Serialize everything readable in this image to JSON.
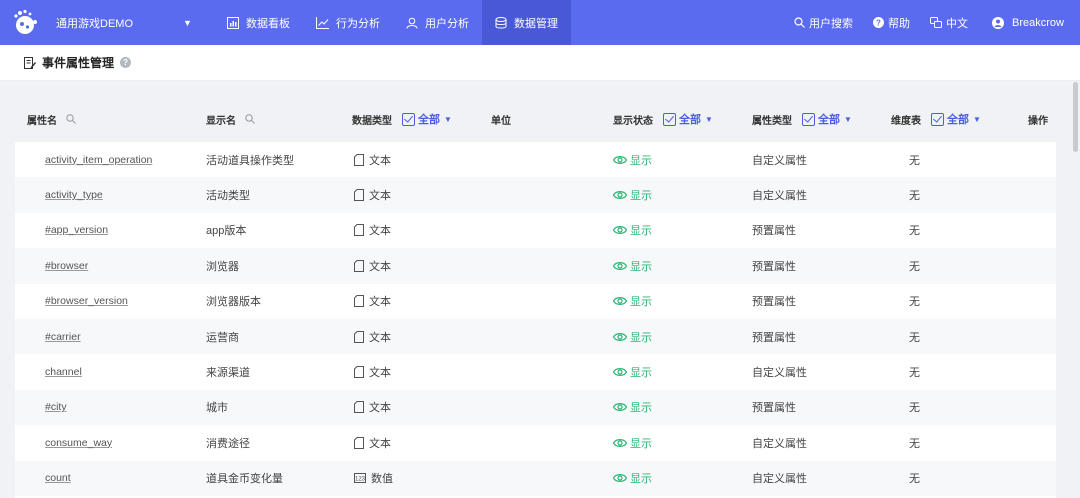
{
  "app": {
    "project": "通用游戏DEMO",
    "nav": [
      {
        "label": "数据看板",
        "icon": "dashboard-icon"
      },
      {
        "label": "行为分析",
        "icon": "trend-chart-icon"
      },
      {
        "label": "用户分析",
        "icon": "user-icon"
      },
      {
        "label": "数据管理",
        "icon": "database-icon",
        "active": true
      }
    ],
    "right": {
      "search": "用户搜索",
      "help": "帮助",
      "lang": "中文",
      "user": "Breakcrow"
    }
  },
  "page": {
    "title": "事件属性管理"
  },
  "table": {
    "headers": {
      "name": "属性名",
      "display": "显示名",
      "datatype": "数据类型",
      "unit": "单位",
      "status": "显示状态",
      "proptype": "属性类型",
      "dim": "维度表",
      "ops": "操作"
    },
    "filter_all": "全部",
    "rows": [
      {
        "name": "activity_item_operation",
        "display": "活动道具操作类型",
        "type": "文本",
        "type_icon": "doc-icon",
        "status": "显示",
        "prop": "自定义属性",
        "dim": "无"
      },
      {
        "name": "activity_type",
        "display": "活动类型",
        "type": "文本",
        "type_icon": "doc-icon",
        "status": "显示",
        "prop": "自定义属性",
        "dim": "无"
      },
      {
        "name": "#app_version",
        "display": "app版本",
        "type": "文本",
        "type_icon": "doc-icon",
        "status": "显示",
        "prop": "预置属性",
        "dim": "无"
      },
      {
        "name": "#browser",
        "display": "浏览器",
        "type": "文本",
        "type_icon": "doc-icon",
        "status": "显示",
        "prop": "预置属性",
        "dim": "无"
      },
      {
        "name": "#browser_version",
        "display": "浏览器版本",
        "type": "文本",
        "type_icon": "doc-icon",
        "status": "显示",
        "prop": "预置属性",
        "dim": "无"
      },
      {
        "name": "#carrier",
        "display": "运营商",
        "type": "文本",
        "type_icon": "doc-icon",
        "status": "显示",
        "prop": "预置属性",
        "dim": "无"
      },
      {
        "name": "channel",
        "display": "来源渠道",
        "type": "文本",
        "type_icon": "doc-icon",
        "status": "显示",
        "prop": "自定义属性",
        "dim": "无"
      },
      {
        "name": "#city",
        "display": "城市",
        "type": "文本",
        "type_icon": "doc-icon",
        "status": "显示",
        "prop": "预置属性",
        "dim": "无"
      },
      {
        "name": "consume_way",
        "display": "消费途径",
        "type": "文本",
        "type_icon": "doc-icon",
        "status": "显示",
        "prop": "自定义属性",
        "dim": "无"
      },
      {
        "name": "count",
        "display": "道具金币变化量",
        "type": "数值",
        "type_icon": "number-icon",
        "status": "显示",
        "prop": "自定义属性",
        "dim": "无"
      }
    ]
  },
  "colors": {
    "nav_bg": "#5b6bf0",
    "nav_active": "#4958d6",
    "accent": "#4a5ee8",
    "status_green": "#2bb673"
  }
}
